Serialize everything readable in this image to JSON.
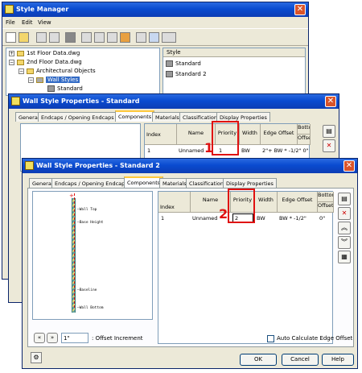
{
  "style_manager": {
    "title": "Style Manager",
    "menus": [
      "File",
      "Edit",
      "View"
    ],
    "tree": {
      "file1": "1st Floor Data.dwg",
      "file2": "2nd Floor Data.dwg",
      "folder": "Architectural Objects",
      "category": "Wall Styles",
      "style": "Standard"
    },
    "list_header": "Style",
    "list_items": [
      "Standard",
      "Standard 2"
    ]
  },
  "wsp1": {
    "title": "Wall Style Properties - Standard",
    "tabs": [
      "General",
      "Endcaps / Opening Endcaps",
      "Components",
      "Materials",
      "Classifications",
      "Display Properties"
    ],
    "headers": {
      "index": "Index",
      "name": "Name",
      "priority": "Priority",
      "width": "Width",
      "edge_offset": "Edge Offset",
      "bottom": "Bottom",
      "offset": "Offset"
    },
    "row": {
      "index": "1",
      "name": "Unnamed",
      "priority": "1",
      "width": "BW",
      "edge_offset": "2\"+ BW * -1/2\" 0\""
    }
  },
  "wsp2": {
    "title": "Wall Style Properties - Standard 2",
    "tabs": [
      "General",
      "Endcaps / Opening Endcaps",
      "Components",
      "Materials",
      "Classifications",
      "Display Properties"
    ],
    "headers": {
      "index": "Index",
      "name": "Name",
      "priority": "Priority",
      "width": "Width",
      "edge_offset": "Edge Offset",
      "bottom": "Bottom",
      "offset": "Offset"
    },
    "row": {
      "index": "1",
      "name": "Unnamed",
      "priority": "2",
      "width": "BW",
      "edge_offset": "BW * -1/2\"",
      "bottom": "0\""
    },
    "preview_labels": {
      "wall_top": "Wall Top",
      "base_height": "Base Height",
      "baseline": "Baseline",
      "wall_bottom": "Wall Bottom"
    },
    "offset_value": "1\"",
    "offset_label": ": Offset Increment",
    "auto_calc_label": "Auto Calculate Edge Offset",
    "ok": "OK",
    "cancel": "Cancel",
    "help": "Help"
  },
  "callouts": [
    "1",
    "2"
  ],
  "colors": {
    "title_blue": "#0a4bd0",
    "highlight_red": "#e01010"
  }
}
